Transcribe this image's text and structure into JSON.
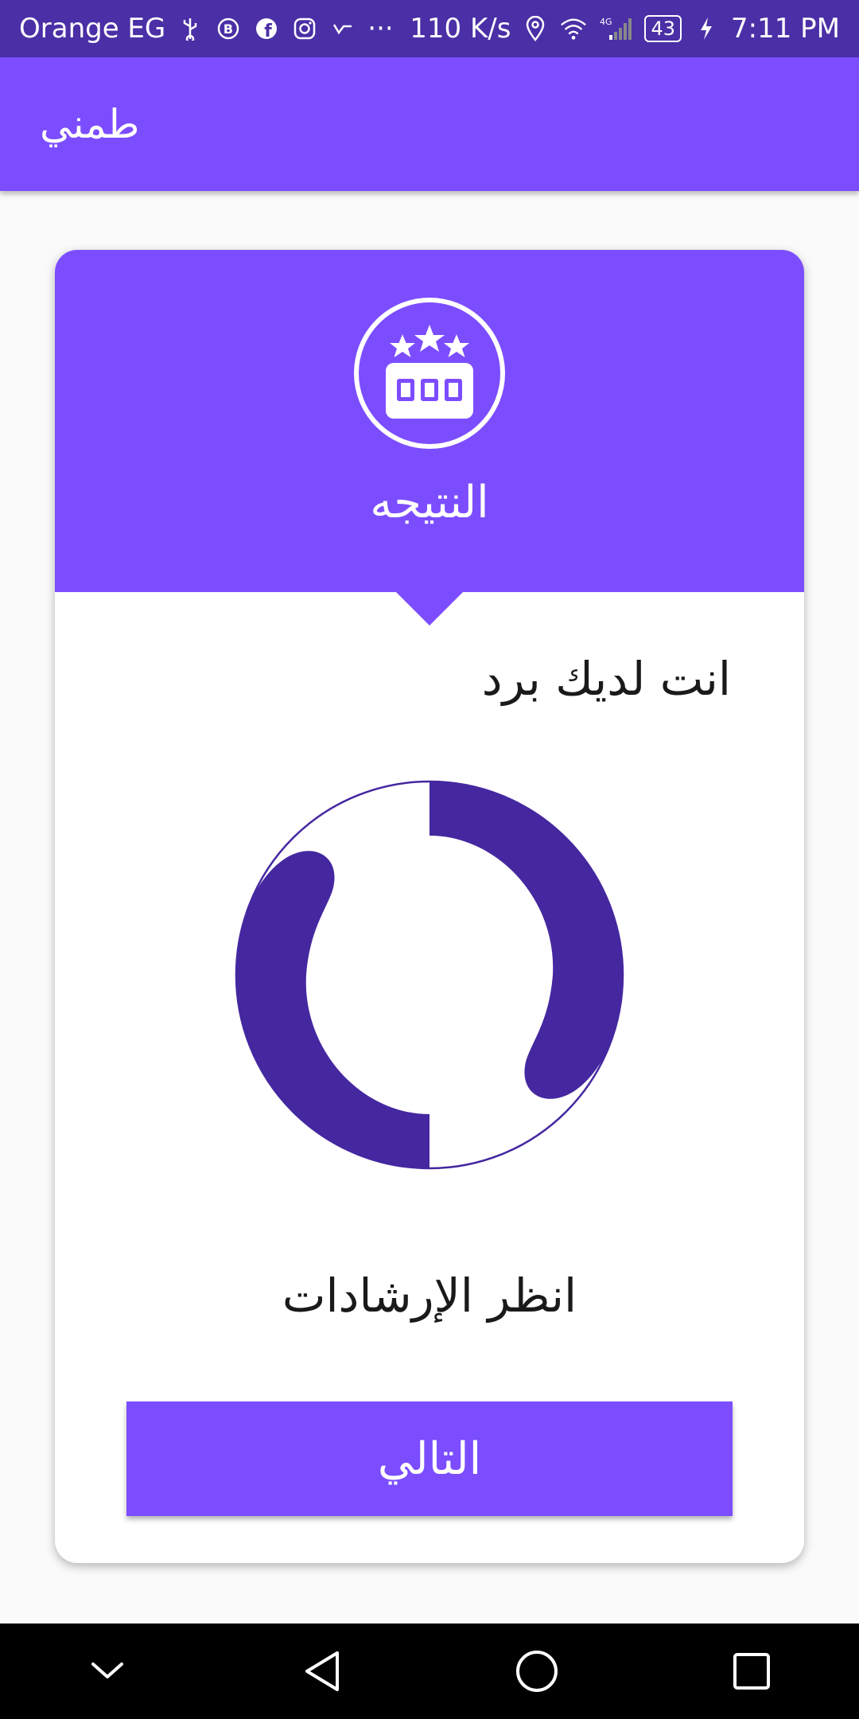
{
  "status_bar": {
    "carrier": "Orange EG",
    "speed": "110 K/s",
    "network": "4G",
    "battery": "43",
    "time": "7:11 PM",
    "more": "···"
  },
  "app_bar": {
    "title": "طمني"
  },
  "card": {
    "header_title": "النتيجه",
    "result_text": "انت لديك برد",
    "guide_text": "انظر الإرشادات",
    "next_label": "التالي"
  },
  "colors": {
    "status_bar": "#4a2fa6",
    "primary": "#7c4dff",
    "result_icon": "#4527a0"
  },
  "icons": {
    "header": "rating-stars-counter-icon",
    "result": "cold-result-image",
    "nav": [
      "chevron-down-icon",
      "back-icon",
      "home-icon",
      "recents-icon"
    ]
  }
}
